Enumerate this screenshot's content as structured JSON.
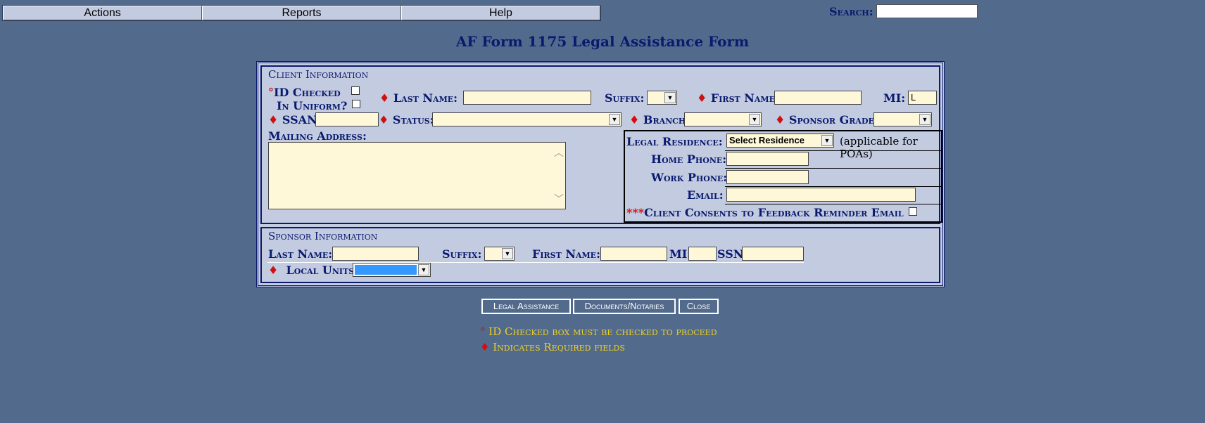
{
  "menu": [
    "Actions",
    "Reports",
    "Help"
  ],
  "search": {
    "label": "Search:",
    "value": ""
  },
  "title": "AF Form 1175 Legal Assistance Form",
  "client": {
    "legend": "Client Information",
    "id_checked_label": "ID Checked",
    "in_uniform_label": "In Uniform?",
    "last_name_label": "Last Name:",
    "suffix_label": "Suffix:",
    "first_name_label": "First Name:",
    "mi_label": "MI:",
    "mi_value": "L",
    "ssan_label": "SSAN:",
    "status_label": "Status:",
    "branch_label": "Branch:",
    "sponsor_grade_label": "Sponsor Grade:",
    "mailing_address_label": "Mailing Address:",
    "legal_residence_label": "Legal Residence:",
    "legal_residence_value": "Select Residence",
    "poa_note": "(applicable for POAs)",
    "home_phone_label": "Home Phone:",
    "work_phone_label": "Work Phone:",
    "email_label": "Email:",
    "consent_stars": "***",
    "consent_label": "Client Consents to Feedback Reminder Email"
  },
  "sponsor": {
    "legend": "Sponsor Information",
    "last_name_label": "Last Name:",
    "suffix_label": "Suffix:",
    "first_name_label": "First Name:",
    "mi_label": "MI:",
    "ssn_label": "SSN:",
    "local_units_label": "Local Units:"
  },
  "buttons": {
    "legal_assistance": "Legal Assistance",
    "documents": "Documents/Notaries",
    "close": "Close"
  },
  "notes": {
    "id_marker": "°",
    "id_note": "ID Checked box must be checked to proceed",
    "req_marker": "♦",
    "req_note": "Indicates Required fields"
  },
  "symbols": {
    "required": "♦",
    "id_required": "°"
  },
  "colors": {
    "background": "#526a8c",
    "panel": "#c3cbe0",
    "label": "#0a1a6e",
    "field": "#fff8d8",
    "required": "#d01010",
    "note": "#f0d020"
  }
}
